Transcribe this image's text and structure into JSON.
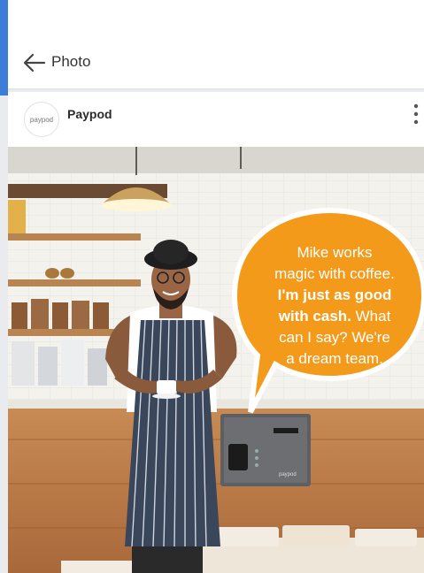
{
  "header": {
    "title": "Photo",
    "back_icon": "arrow-left-icon"
  },
  "post": {
    "avatar_text": "paypod",
    "account_name": "Paypod",
    "more_icon": "more-vertical-icon"
  },
  "image": {
    "bubble_line1": "Mike works",
    "bubble_line2": "magic with coffee.",
    "bubble_bold_line3": "I'm just as good",
    "bubble_bold_line4": "with cash.",
    "bubble_line4_rest": " What",
    "bubble_line5": "can I say? We're",
    "bubble_line6": "a dream team.",
    "device_label": "paypod"
  },
  "colors": {
    "accent": "#3b7dd8",
    "bubble": "#f39a1b"
  }
}
